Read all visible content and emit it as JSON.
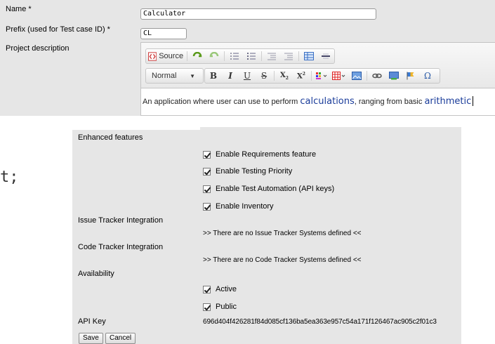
{
  "form": {
    "name_label": "Name *",
    "name_value": "Calculator",
    "prefix_label": "Prefix (used for Test case ID) *",
    "prefix_value": "CL",
    "description_label": "Project description"
  },
  "editor": {
    "source_label": "Source",
    "format_value": "Normal",
    "content_prefix": "An application where user can use to perform ",
    "content_hl1": "calculations",
    "content_mid": ", ranging from basic ",
    "content_hl2": "arithmetic",
    "icons": [
      "source-icon",
      "undo-icon",
      "redo-icon",
      "numbered-list-icon",
      "bulleted-list-icon",
      "outdent-icon",
      "indent-icon",
      "table-icon",
      "horizontal-rule-icon",
      "bold-icon",
      "italic-icon",
      "underline-icon",
      "strikethrough-icon",
      "subscript-icon",
      "superscript-icon",
      "text-color-icon",
      "background-color-icon",
      "image-icon",
      "link-icon",
      "unlink-icon",
      "flag-icon",
      "special-char-icon"
    ]
  },
  "settings": {
    "enhanced_label": "Enhanced features",
    "req_label": "Enable Requirements feature",
    "priority_label": "Enable Testing Priority",
    "automation_label": "Enable Test Automation (API keys)",
    "inventory_label": "Enable Inventory",
    "issue_label": "Issue Tracker Integration",
    "issue_msg": ">> There are no Issue Tracker Systems defined <<",
    "code_label": "Code Tracker Integration",
    "code_msg": ">> There are no Code Tracker Systems defined <<",
    "availability_label": "Availability",
    "active_label": "Active",
    "public_label": "Public",
    "api_label": "API Key",
    "api_value": "696d404f426281f84d085cf136ba5ea363e957c54a171f126467ac905c2f01c3"
  },
  "actions": {
    "save_label": "Save",
    "cancel_label": "Cancel"
  },
  "background": {
    "left_glyph": "t;"
  }
}
